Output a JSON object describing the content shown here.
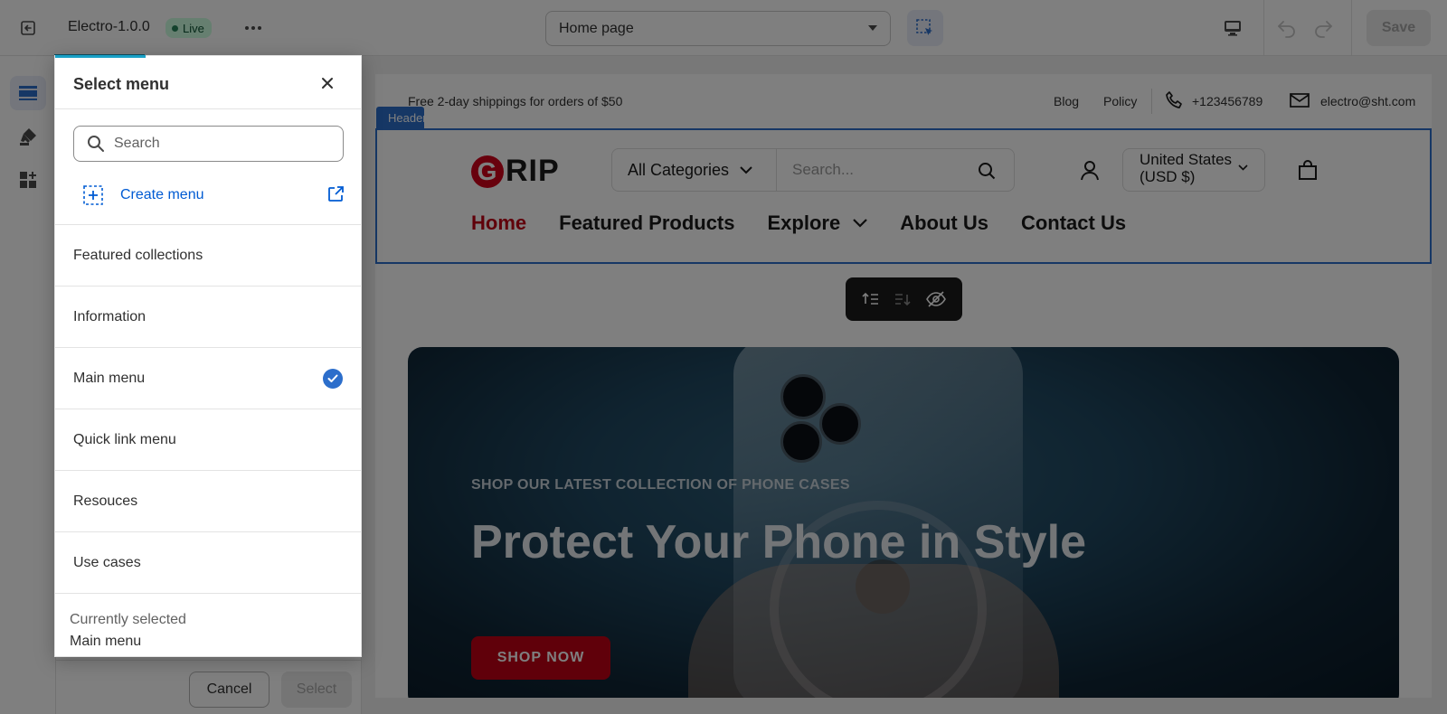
{
  "topbar": {
    "theme_name": "Electro-1.0.0",
    "status_badge": "Live",
    "page_selector": "Home page",
    "save_label": "Save"
  },
  "sidebar": {
    "cancel_label": "Cancel",
    "select_label": "Select"
  },
  "dialog": {
    "title": "Select menu",
    "search_placeholder": "Search",
    "create_label": "Create menu",
    "items": [
      {
        "label": "Featured collections",
        "selected": false
      },
      {
        "label": "Information",
        "selected": false
      },
      {
        "label": "Main menu",
        "selected": true
      },
      {
        "label": "Quick link menu",
        "selected": false
      },
      {
        "label": "Resouces",
        "selected": false
      },
      {
        "label": "Use cases",
        "selected": false
      }
    ],
    "current_label": "Currently selected",
    "current_value": "Main menu"
  },
  "preview": {
    "announcement": "Free 2-day shippings for orders of $50",
    "top_links": [
      "Blog",
      "Policy"
    ],
    "phone": "+123456789",
    "email": "electro@sht.com",
    "section_tag": "Header",
    "logo_letter": "G",
    "logo_rest": "RIP",
    "category_select": "All Categories",
    "search_placeholder": "Search...",
    "currency": "United States (USD $)",
    "nav": [
      "Home",
      "Featured Products",
      "Explore",
      "About Us",
      "Contact Us"
    ],
    "hero_subtitle": "SHOP OUR LATEST COLLECTION OF PHONE CASES",
    "hero_title": "Protect Your Phone in Style",
    "hero_button": "SHOP NOW"
  },
  "colors": {
    "accent_blue": "#2c6ecb",
    "link_blue": "#005bd3",
    "brand_red": "#c10015",
    "live_green": "#cdfee1",
    "progress_teal": "#19a0c6"
  },
  "icons": [
    "exit-icon",
    "more-icon",
    "inspect-icon",
    "desktop-icon",
    "undo-icon",
    "redo-icon",
    "sections-icon",
    "theme-settings-icon",
    "apps-icon",
    "close-icon",
    "search-icon",
    "add-menu-icon",
    "external-link-icon",
    "checkmark-icon",
    "phone-icon",
    "mail-icon",
    "user-icon",
    "cart-icon",
    "chevron-down-icon",
    "move-up-icon",
    "move-down-icon",
    "hide-icon",
    "drag-handle-icon"
  ]
}
